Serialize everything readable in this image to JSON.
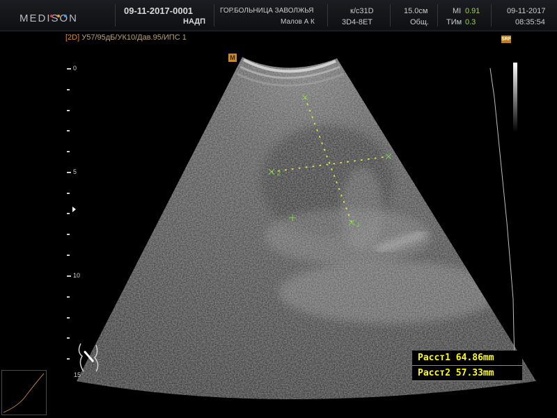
{
  "header": {
    "brand": "MEDISON",
    "patient_id": "09-11-2017-0001",
    "patient_name": "НАДП",
    "hospital": "ГОР.БОЛЬНИЦА ЗАВОЛЖЬЯ",
    "operator": "Малов А К",
    "preset": "к/с31D",
    "probe": "3D4-8ET",
    "depth": "15.0см",
    "application": "Общ.",
    "mi_label": "MI",
    "mi_value": "0.91",
    "tim_label": "ТИм",
    "tim_value": "0.3",
    "date": "09-11-2017",
    "time": "08:35:54"
  },
  "mode": {
    "tag": "[2D]",
    "params": "У57/95дБ/УК10/Дав.95/ИПС 1"
  },
  "icons": {
    "m_marker": "M",
    "srf_marker": "SRF"
  },
  "depth_scale": {
    "labels": [
      "0",
      "5",
      "10",
      "15"
    ]
  },
  "measurements": [
    {
      "label": "Расст1",
      "value": "64.86mm"
    },
    {
      "label": "Расст2",
      "value": "57.33mm"
    }
  ],
  "calipers": {
    "marker_1": "1",
    "marker_2": "2"
  },
  "colors": {
    "measurement_text": "#ffff00",
    "caliper": "#7fd14b",
    "mode_tag": "#e08a2e"
  }
}
